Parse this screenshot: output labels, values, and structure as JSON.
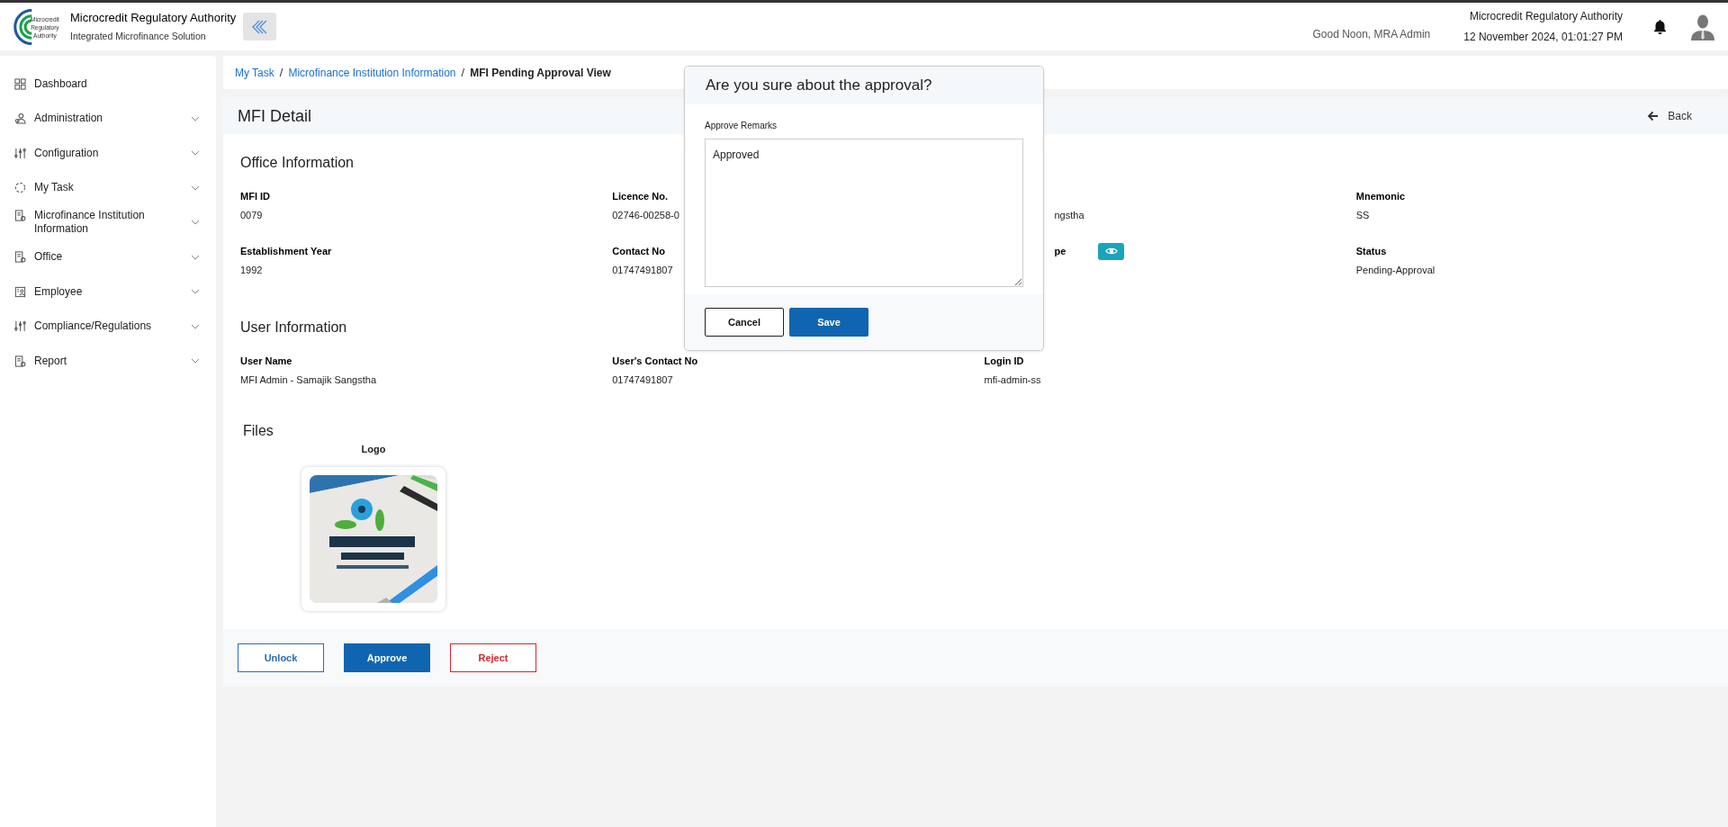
{
  "header": {
    "logo_text": [
      "Microcredit",
      "Regulatory",
      "Authority"
    ],
    "title": "Microcredit Regulatory Authority",
    "subtitle": "Integrated Microfinance Solution",
    "greeting": "Good Noon, MRA Admin",
    "org": "Microcredit Regulatory Authority",
    "datetime": "12 November 2024, 01:01:27 PM"
  },
  "sidebar": {
    "items": [
      {
        "label": "Dashboard",
        "kind": "grid",
        "has_submenu": false
      },
      {
        "label": "Administration",
        "kind": "users",
        "has_submenu": true
      },
      {
        "label": "Configuration",
        "kind": "sliders",
        "has_submenu": true
      },
      {
        "label": "My Task",
        "kind": "loader",
        "has_submenu": true
      },
      {
        "label": "Microfinance Institution Information",
        "kind": "doc",
        "has_submenu": true
      },
      {
        "label": "Office",
        "kind": "doc",
        "has_submenu": true
      },
      {
        "label": "Employee",
        "kind": "badge",
        "has_submenu": true
      },
      {
        "label": "Compliance/Regulations",
        "kind": "sliders",
        "has_submenu": true
      },
      {
        "label": "Report",
        "kind": "doc",
        "has_submenu": true
      }
    ]
  },
  "breadcrumb": [
    {
      "label": "My Task",
      "link": true
    },
    {
      "separator": "/"
    },
    {
      "label": "Microfinance Institution Information",
      "link": true
    },
    {
      "separator": "/"
    },
    {
      "label": "MFI Pending Approval View",
      "link": false
    }
  ],
  "detail": {
    "title": "MFI Detail",
    "back": "Back",
    "sections": [
      {
        "title": "Office Information",
        "rows": [
          [
            {
              "label": "MFI ID",
              "value": "0079"
            },
            {
              "label": "Licence No.",
              "value": "02746-00258-0"
            },
            {
              "value": "ngstha",
              "partial": true
            },
            {
              "label": "Mnemonic",
              "value": "SS"
            }
          ],
          [
            {
              "label": "Establishment Year",
              "value": "1992"
            },
            {
              "label": "Contact No",
              "value": "01747491807"
            },
            {
              "label": "pe",
              "partial": true,
              "view_button": true
            },
            {
              "label": "Status",
              "value": "Pending-Approval"
            }
          ]
        ]
      },
      {
        "title": "User Information",
        "rows": [
          [
            {
              "label": "User Name",
              "value": "MFI Admin - Samajik Sangstha"
            },
            {
              "label": "User's Contact No",
              "value": "01747491807"
            },
            {
              "label": "Login ID",
              "value": "mfi-admin-ss"
            }
          ]
        ]
      }
    ],
    "files_title": "Files",
    "files": [
      {
        "label": "Logo",
        "kind": "picture"
      }
    ],
    "actions": [
      {
        "label": "Unlock",
        "kind": "outline"
      },
      {
        "label": "Approve",
        "kind": "primary"
      },
      {
        "label": "Reject",
        "kind": "danger"
      }
    ]
  },
  "modal": {
    "title": "Are you sure about the approval?",
    "field_label": "Approve Remarks",
    "value": "Approved",
    "buttons": [
      {
        "label": "Cancel",
        "kind": "outline"
      },
      {
        "label": "Save",
        "kind": "primary"
      }
    ]
  }
}
